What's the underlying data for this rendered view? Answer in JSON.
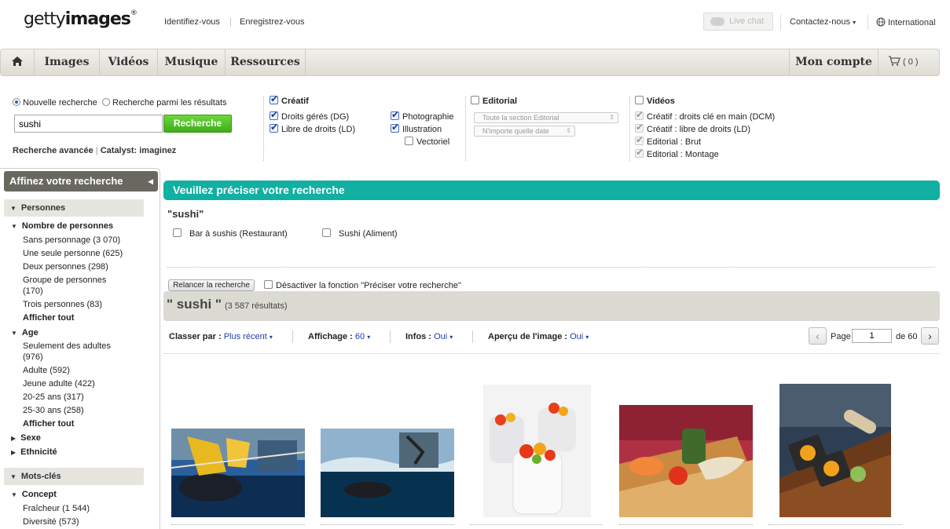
{
  "header": {
    "logo_regular": "getty",
    "logo_bold": "images",
    "logo_mark": "®",
    "login": "Identifiez-vous",
    "register": "Enregistrez-vous",
    "live_chat": "Live chat",
    "contact": "Contactez-nous",
    "international": "International"
  },
  "nav": {
    "items": [
      "Images",
      "Vidéos",
      "Musique",
      "Ressources"
    ],
    "account": "Mon compte",
    "cart_count": "( 0 )"
  },
  "search": {
    "new_search": "Nouvelle recherche",
    "within_results": "Recherche parmi les résultats",
    "query": "sushi",
    "button": "Recherche",
    "advanced": "Recherche avancée",
    "catalyst": "Catalyst: imaginez"
  },
  "filters": {
    "creative": {
      "label": "Créatif",
      "dg": "Droits gérés (DG)",
      "ld": "Libre de droits (LD)",
      "photo": "Photographie",
      "illustration": "Illustration",
      "vector": "Vectoriel"
    },
    "editorial": {
      "label": "Editorial",
      "section_select": "Toute la section Editorial",
      "date_select": "N'importe quelle date"
    },
    "videos": {
      "label": "Vidéos",
      "dcm": "Créatif : droits clé en main (DCM)",
      "ld": "Créatif : libre de droits (LD)",
      "brut": "Editorial : Brut",
      "montage": "Editorial : Montage"
    }
  },
  "sidebar": {
    "title": "Affinez votre recherche",
    "persons_section": "Personnes",
    "nb_persons": "Nombre de personnes",
    "nb_items": [
      "Sans personnage (3 070)",
      "Une seule personne (625)",
      "Deux personnes (298)",
      "Groupe de personnes",
      "(170)",
      "Trois personnes (83)"
    ],
    "show_all": "Afficher tout",
    "age": "Age",
    "age_items": [
      "Seulement des adultes",
      "(976)",
      "Adulte (592)",
      "Jeune adulte (422)",
      "20-25 ans (317)",
      "25-30 ans (258)"
    ],
    "sex": "Sexe",
    "ethnicity": "Ethnicité",
    "keywords_section": "Mots-clés",
    "concept": "Concept",
    "concept_items": [
      "Fraîcheur (1 544)",
      "Diversité (573)"
    ]
  },
  "refine": {
    "banner": "Veuillez préciser votre recherche",
    "term": "\"sushi\"",
    "option1": "Bar à sushis (Restaurant)",
    "option2": "Sushi (Aliment)",
    "rerun": "Relancer la recherche",
    "disable": "Désactiver la fonction \"Préciser votre recherche\""
  },
  "results": {
    "query_display": "\" sushi \"",
    "count": "(3 587 résultats)",
    "sort_label": "Classer par :",
    "sort_value": "Plus récent",
    "display_label": "Affichage :",
    "display_value": "60",
    "info_label": "Infos :",
    "info_value": "Oui",
    "preview_label": "Aperçu de l'image :",
    "preview_value": "Oui",
    "page_label": "Page",
    "page_value": "1",
    "page_of": "de 60"
  },
  "colors": {
    "accent_teal": "#11b0a2",
    "search_green": "#4bbd22",
    "link_blue": "#1f3fa8"
  }
}
